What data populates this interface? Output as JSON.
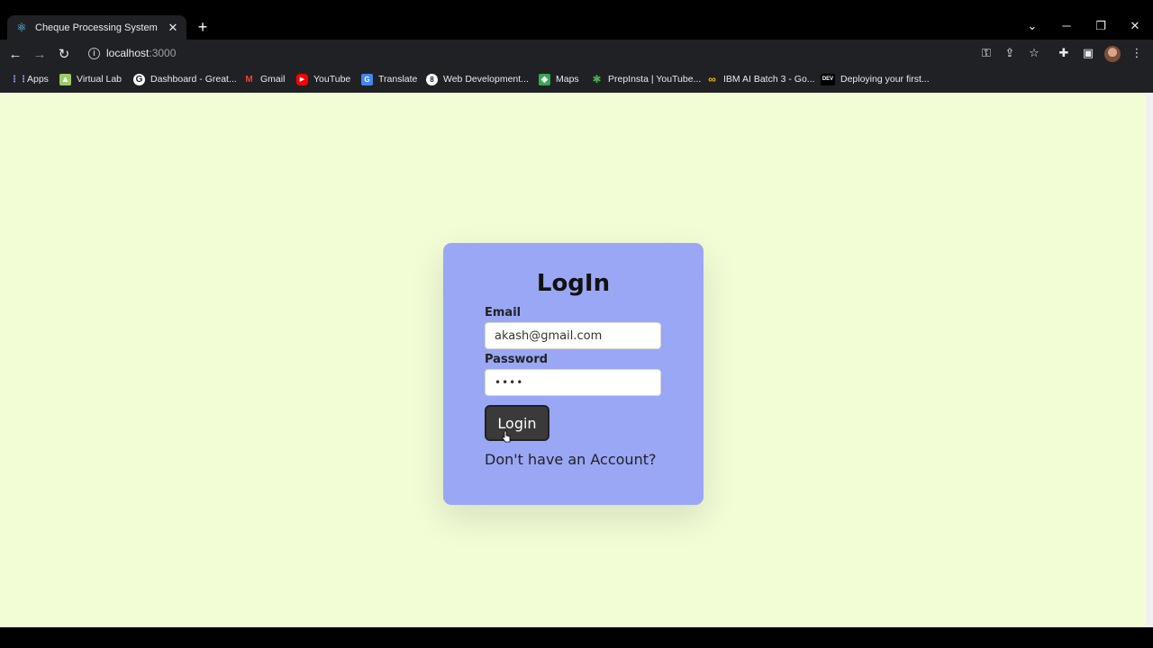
{
  "browser": {
    "tab": {
      "title": "Cheque Processing System",
      "favicon": "react-icon",
      "close_icon": "close-icon"
    },
    "new_tab_icon": "plus-icon",
    "window_controls": [
      "chevron-down-icon",
      "minimize-icon",
      "restore-icon",
      "close-icon"
    ],
    "nav": [
      "back-icon",
      "forward-icon",
      "reload-icon"
    ],
    "url": {
      "host": "localhost",
      "port": ":3000"
    },
    "toolbar_icons": [
      "key-icon",
      "share-icon",
      "star-icon",
      "extensions-icon",
      "sidepanel-icon",
      "avatar",
      "menu-icon"
    ],
    "bookmarks": [
      {
        "label": "Apps",
        "icon": "apps-grid-icon",
        "color": "#8ab4f8"
      },
      {
        "label": "Virtual Lab",
        "icon": "virtual-lab-icon",
        "color": "#9ccc65"
      },
      {
        "label": "Dashboard - Great...",
        "icon": "g-icon",
        "color": "#ffffff"
      },
      {
        "label": "Gmail",
        "icon": "gmail-icon",
        "color": "#ea4335"
      },
      {
        "label": "YouTube",
        "icon": "youtube-icon",
        "color": "#ff0000"
      },
      {
        "label": "Translate",
        "icon": "translate-icon",
        "color": "#4285f4"
      },
      {
        "label": "Web Development...",
        "icon": "web-dev-icon",
        "color": "#ffffff"
      },
      {
        "label": "Maps",
        "icon": "maps-icon",
        "color": "#34a853"
      },
      {
        "label": "PrepInsta | YouTube...",
        "icon": "prepinsta-icon",
        "color": "#4caf50"
      },
      {
        "label": "IBM AI Batch 3 - Go...",
        "icon": "infinity-icon",
        "color": "#ffb300"
      },
      {
        "label": "Deploying your first...",
        "icon": "dev-icon",
        "color": "#ffffff"
      }
    ]
  },
  "page": {
    "background": "#f2fdd6",
    "card_color": "#9aa7f5",
    "title": "LogIn",
    "email_label": "Email",
    "email_value": "akash@gmail.com",
    "password_label": "Password",
    "password_value": "••••",
    "login_button": "Login",
    "signup_link": "Don't have an Account?"
  }
}
